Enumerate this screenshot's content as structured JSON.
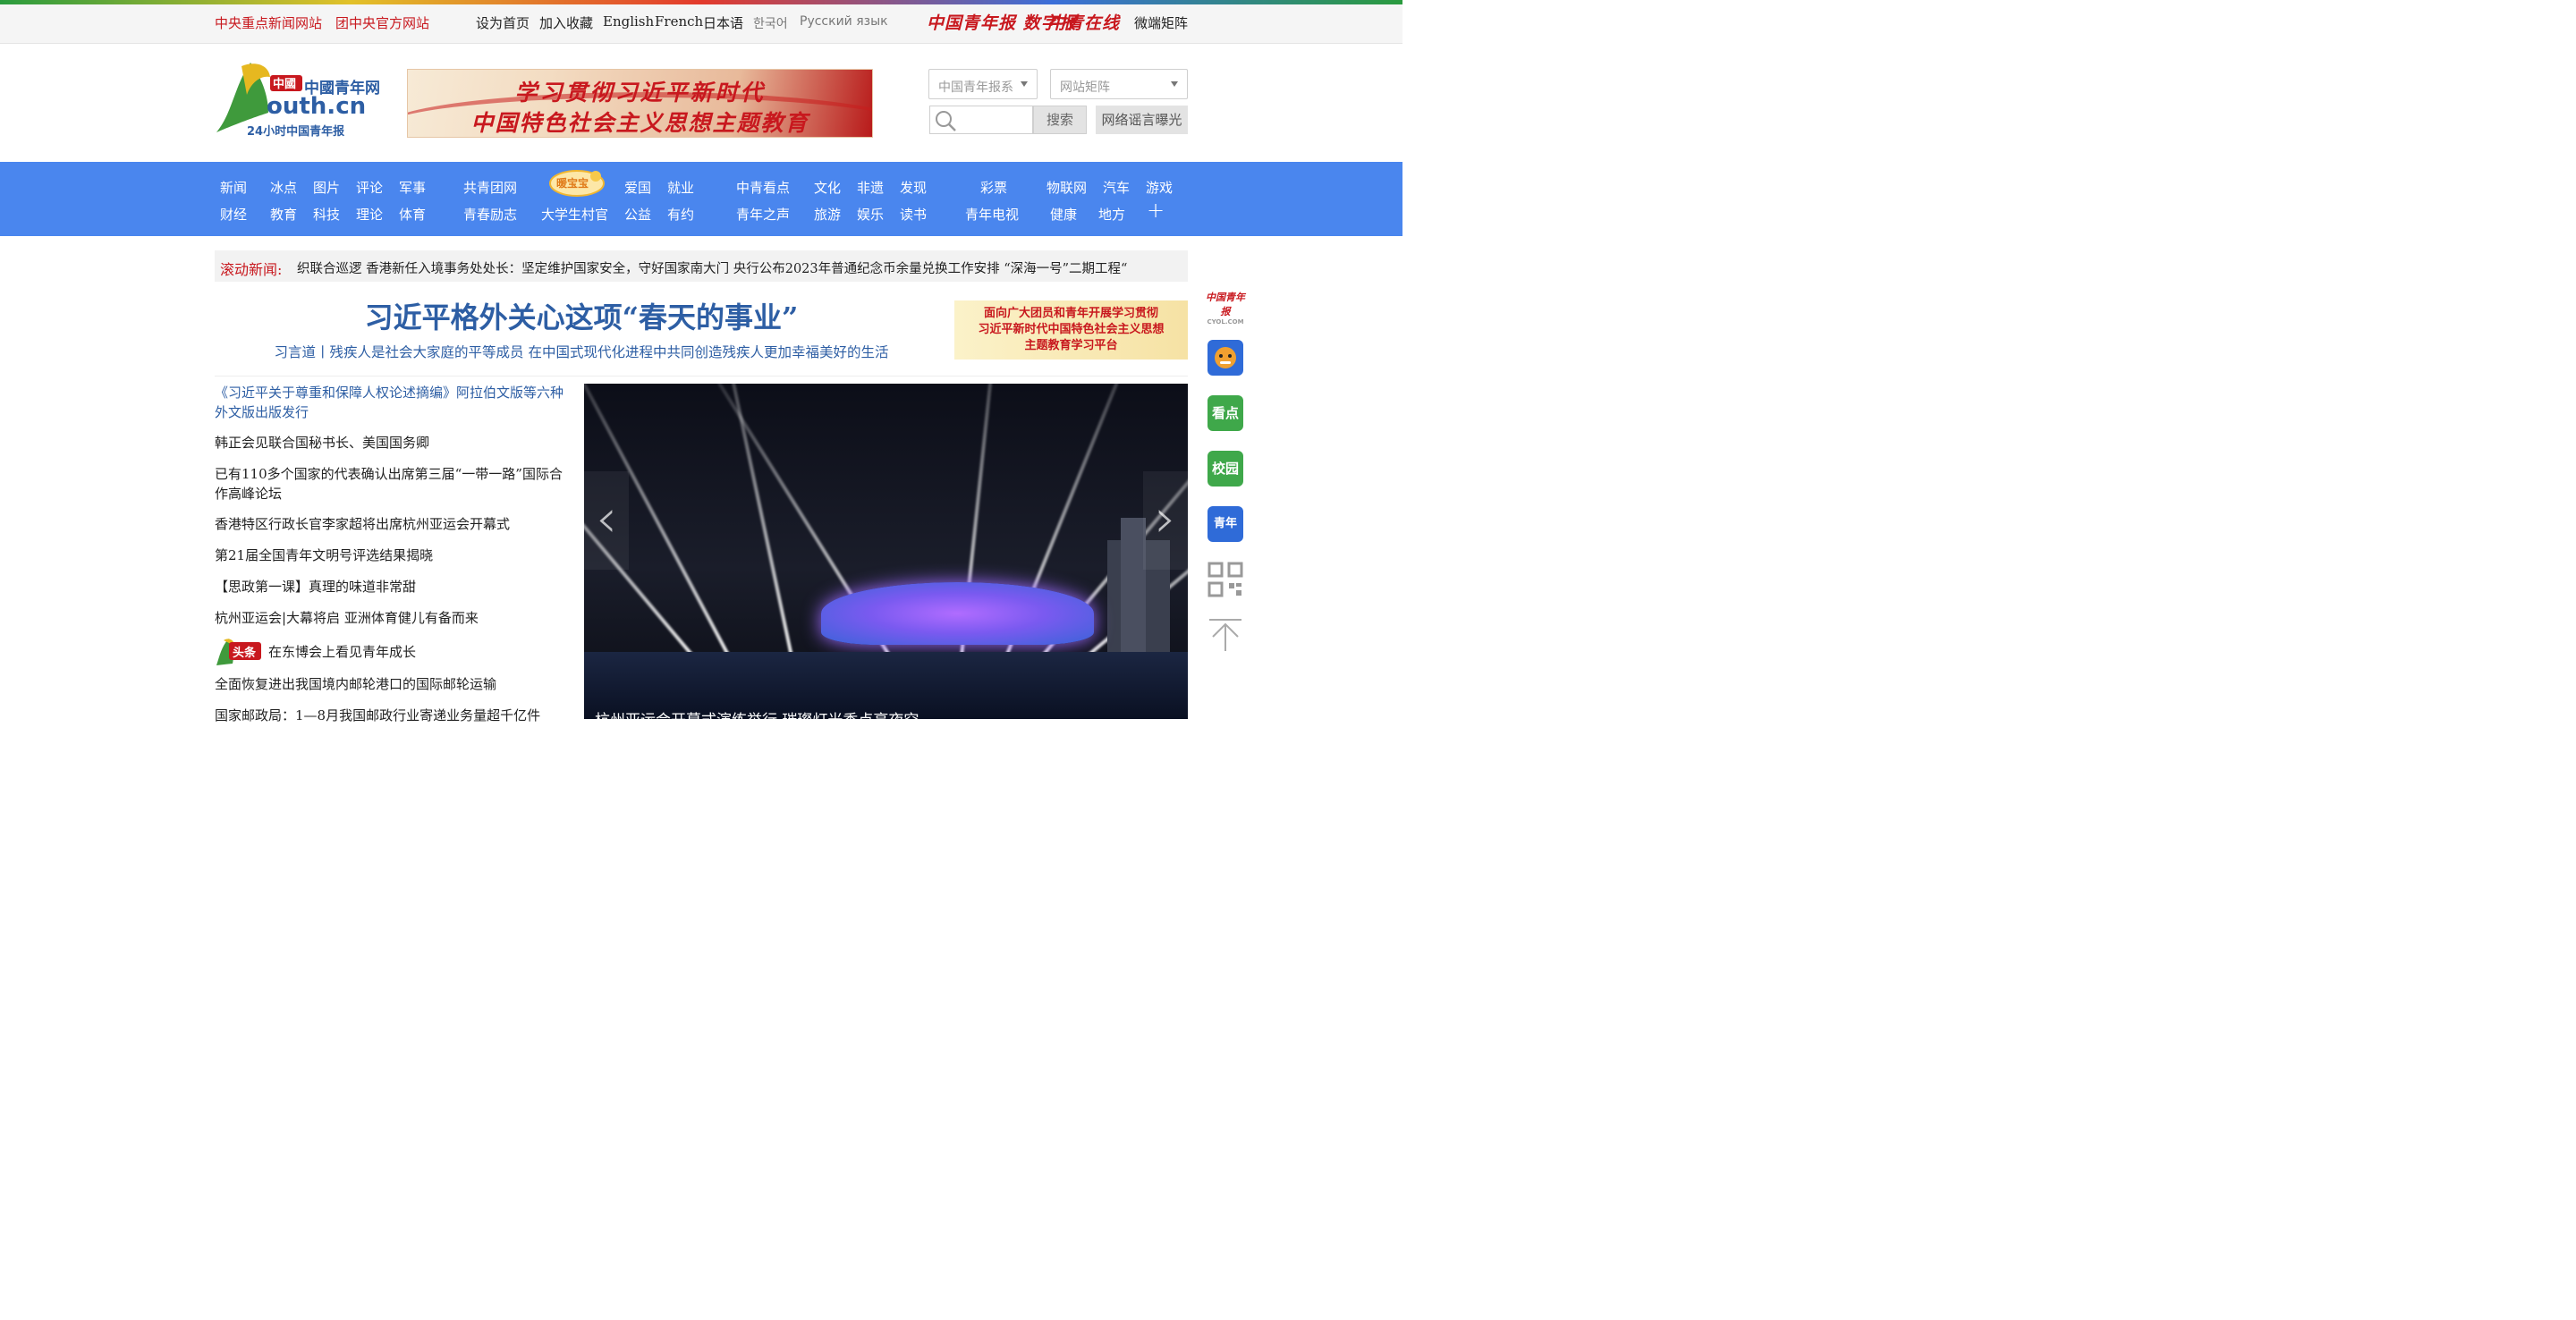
{
  "topbar": {
    "left_links": [
      "中央重点新闻网站",
      "团中央官方网站"
    ],
    "mid_links": [
      "设为首页",
      "加入收藏",
      "English",
      "French",
      "日本语"
    ],
    "gray_links": [
      "한국어",
      "Русский язык"
    ],
    "logo1": "中国青年报 数字报",
    "logo2": "中青在线",
    "matrix": "微端矩阵"
  },
  "header": {
    "logo_cn": "中國青年网",
    "logo_domain": "outh.cn",
    "logo_sub": "24小时中国青年报",
    "banner_line1": "学习贯彻习近平新时代",
    "banner_line2": "中国特色社会主义思想主题教育",
    "select1": "中国青年报系",
    "select2": "网站矩阵",
    "search_btn": "搜索",
    "rumor_btn": "网络谣言曝光"
  },
  "nav": {
    "row1": [
      "新闻",
      "冰点",
      "图片",
      "评论",
      "军事",
      "共青团网",
      "爱国",
      "就业",
      "中青看点",
      "文化",
      "非遗",
      "发现",
      "彩票",
      "物联网",
      "汽车",
      "游戏"
    ],
    "row2": [
      "财经",
      "教育",
      "科技",
      "理论",
      "体育",
      "青春励志",
      "大学生村官",
      "公益",
      "有约",
      "青年之声",
      "旅游",
      "娱乐",
      "读书",
      "青年电视",
      "健康",
      "地方"
    ],
    "baobao": "暖宝宝",
    "more": "+"
  },
  "ticker": {
    "label": "滚动新闻:",
    "text": "织联合巡逻   香港新任入境事务处处长：坚定维护国家安全，守好国家南大门   央行公布2023年普通纪念币余量兑换工作安排  “深海一号”二期工程“"
  },
  "main": {
    "headline": "习近平格外关心这项“春天的事业”",
    "subhead": "习言道丨残疾人是社会大家庭的平等成员 在中国式现代化进程中共同创造残疾人更加幸福美好的生活",
    "promo": [
      "面向广大团员和青年开展学习贯彻",
      "习近平新时代中国特色社会主义思想",
      "主题教育学习平台"
    ],
    "toutiao_label": "头条",
    "news": [
      "《习近平关于尊重和保障人权论述摘编》阿拉伯文版等六种外文版出版发行",
      "韩正会见联合国秘书长、美国国务卿",
      "已有110多个国家的代表确认出席第三届“一带一路”国际合作高峰论坛",
      "香港特区行政长官李家超将出席杭州亚运会开幕式",
      "第21届全国青年文明号评选结果揭晓",
      "【思政第一课】真理的味道非常甜",
      "杭州亚运会|大幕将启 亚洲体育健儿有备而来",
      "在东博会上看见青年成长",
      "全面恢复进出我国境内邮轮港口的国际邮轮运输",
      "国家邮政局：1—8月我国邮政行业寄递业务量超千亿件"
    ],
    "slide_caption": "杭州亚运会开幕式演练举行 璀璨灯光秀点亮夜空"
  },
  "sidebar": {
    "logo": "中国青年报",
    "logo_sub": "CYOL.COM",
    "items": [
      "看点",
      "校园",
      "青年"
    ]
  }
}
